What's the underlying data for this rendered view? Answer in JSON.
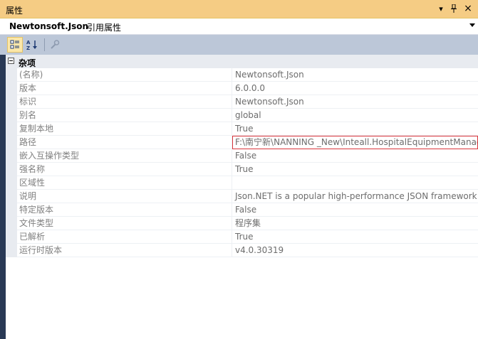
{
  "window": {
    "title": "属性",
    "dropdown_glyph": "▾",
    "pin_glyph": "ᛘ",
    "close_glyph": "×"
  },
  "object": {
    "name": "Newtonsoft.Json",
    "type": "引用属性"
  },
  "category": {
    "label": "杂项"
  },
  "properties": [
    {
      "name": "(名称)",
      "value": "Newtonsoft.Json"
    },
    {
      "name": "版本",
      "value": "6.0.0.0"
    },
    {
      "name": "标识",
      "value": "Newtonsoft.Json"
    },
    {
      "name": "别名",
      "value": "global"
    },
    {
      "name": "复制本地",
      "value": "True"
    },
    {
      "name": "路径",
      "value": "F:\\南宁新\\NANNING _New\\Inteall.HospitalEquipmentManagem"
    },
    {
      "name": "嵌入互操作类型",
      "value": "False"
    },
    {
      "name": "强名称",
      "value": "True"
    },
    {
      "name": "区域性",
      "value": ""
    },
    {
      "name": "说明",
      "value": "Json.NET is a popular high-performance JSON framework"
    },
    {
      "name": "特定版本",
      "value": "False"
    },
    {
      "name": "文件类型",
      "value": "程序集"
    },
    {
      "name": "已解析",
      "value": "True"
    },
    {
      "name": "运行时版本",
      "value": "v4.0.30319"
    }
  ],
  "selected_index": 5,
  "colors": {
    "titlebar": "#f5cc84",
    "toolbar": "#bcc7d8",
    "background": "#293955",
    "selection_outline": "#d9343a"
  }
}
